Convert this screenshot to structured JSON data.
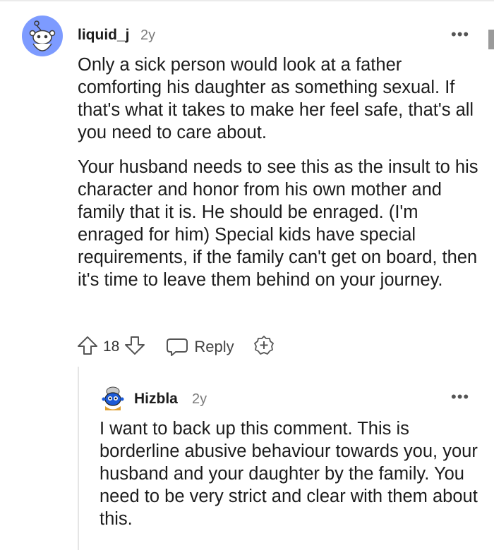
{
  "comments": [
    {
      "author": "liquid_j",
      "time": "2y",
      "paragraphs": [
        "Only a sick person would look at a father comforting his daughter as something sexual. If that's what it takes to make her feel safe, that's all you need to care about.",
        "Your husband needs to see this as the insult to his character and honor from his own mother and family that it is. He should be enraged. (I'm enraged for him) Special kids have special requirements, if the family can't get on board, then it's time to leave them behind on your journey."
      ],
      "votes": "18",
      "reply_label": "Reply",
      "more": "•••",
      "avatar_icon": "snoo-avatar-icon"
    },
    {
      "author": "Hizbla",
      "time": "2y",
      "paragraphs": [
        "I want to back up this comment. This is borderline abusive behaviour towards you, your husband and your daughter by the family. You need to be very strict and clear with them about this."
      ],
      "more": "•••",
      "avatar_icon": "snoo-avatar-icon"
    }
  ],
  "colors": {
    "avatar_bg": "#7d9bff",
    "text": "#1c1c1c",
    "meta": "#7c7c7c",
    "thread_line": "#e5e5e5"
  }
}
